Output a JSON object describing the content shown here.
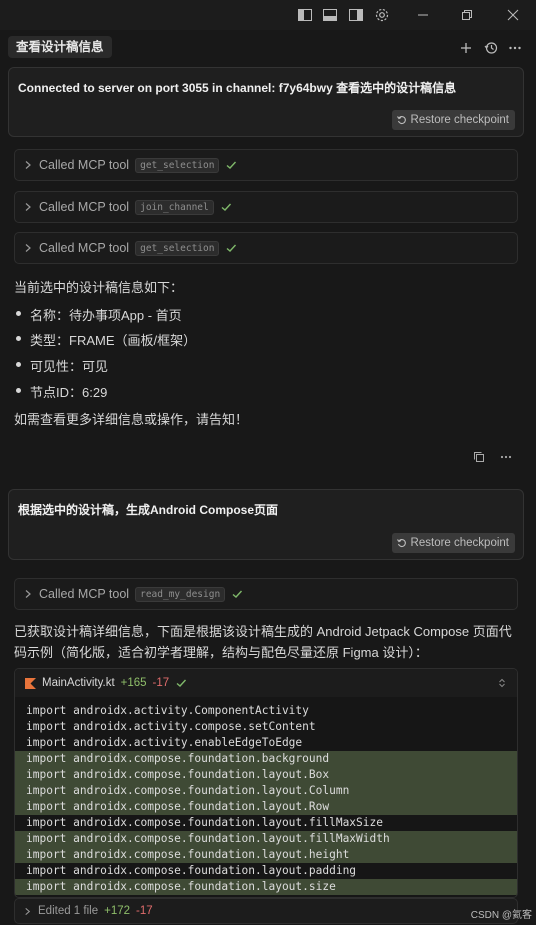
{
  "titlebar": {
    "icons": [
      "toggle-left-panel-icon",
      "toggle-bottom-panel-icon",
      "toggle-right-panel-icon",
      "settings-gear-icon",
      "minimize-icon",
      "restore-icon",
      "close-icon"
    ]
  },
  "tab": {
    "title": "查看设计稿信息",
    "actions": [
      "new-chat-icon",
      "history-icon",
      "more-icon"
    ]
  },
  "messages": [
    {
      "user_text": "Connected to server on port 3055 in channel: f7y64bwy  查看选中的设计稿信息",
      "checkpoint_label": "Restore checkpoint"
    },
    {
      "user_text": "根据选中的设计稿，生成Android Compose页面",
      "checkpoint_label": "Restore checkpoint"
    }
  ],
  "tool_calls": [
    {
      "label": "Called MCP tool",
      "tool": "get_selection"
    },
    {
      "label": "Called MCP tool",
      "tool": "join_channel"
    },
    {
      "label": "Called MCP tool",
      "tool": "get_selection"
    },
    {
      "label": "Called MCP tool",
      "tool": "read_my_design"
    }
  ],
  "response1": {
    "intro": "当前选中的设计稿信息如下：",
    "items": [
      "名称：待办事项App - 首页",
      "类型：FRAME（画板/框架）",
      "可见性：可见",
      "节点ID：6:29"
    ],
    "outro": "如需查看更多详细信息或操作，请告知！"
  },
  "response2": {
    "text": "已获取设计稿详细信息，下面是根据该设计稿生成的 Android Jetpack Compose 页面代码示例（简化版，适合初学者理解，结构与配色尽量还原 Figma 设计）："
  },
  "code": {
    "filename": "MainActivity.kt",
    "additions": "+165",
    "deletions": "-17",
    "lines": [
      {
        "text": "import androidx.activity.ComponentActivity",
        "added": false
      },
      {
        "text": "import androidx.activity.compose.setContent",
        "added": false
      },
      {
        "text": "import androidx.activity.enableEdgeToEdge",
        "added": false
      },
      {
        "text": "import androidx.compose.foundation.background",
        "added": true
      },
      {
        "text": "import androidx.compose.foundation.layout.Box",
        "added": true
      },
      {
        "text": "import androidx.compose.foundation.layout.Column",
        "added": true
      },
      {
        "text": "import androidx.compose.foundation.layout.Row",
        "added": true
      },
      {
        "text": "import androidx.compose.foundation.layout.fillMaxSize",
        "added": false
      },
      {
        "text": "import androidx.compose.foundation.layout.fillMaxWidth",
        "added": true
      },
      {
        "text": "import androidx.compose.foundation.layout.height",
        "added": true
      },
      {
        "text": "import androidx.compose.foundation.layout.padding",
        "added": false
      },
      {
        "text": "import androidx.compose.foundation.layout.size",
        "added": true
      }
    ]
  },
  "edited_summary": {
    "label": "Edited 1 file",
    "additions": "+172",
    "deletions": "-17"
  },
  "watermark": "CSDN @氦客",
  "colors": {
    "background": "#181818",
    "added_line": "#3f4a35",
    "addition_text": "#8fbf6a",
    "deletion_text": "#e06c6c",
    "check_green": "#7fb86a"
  }
}
